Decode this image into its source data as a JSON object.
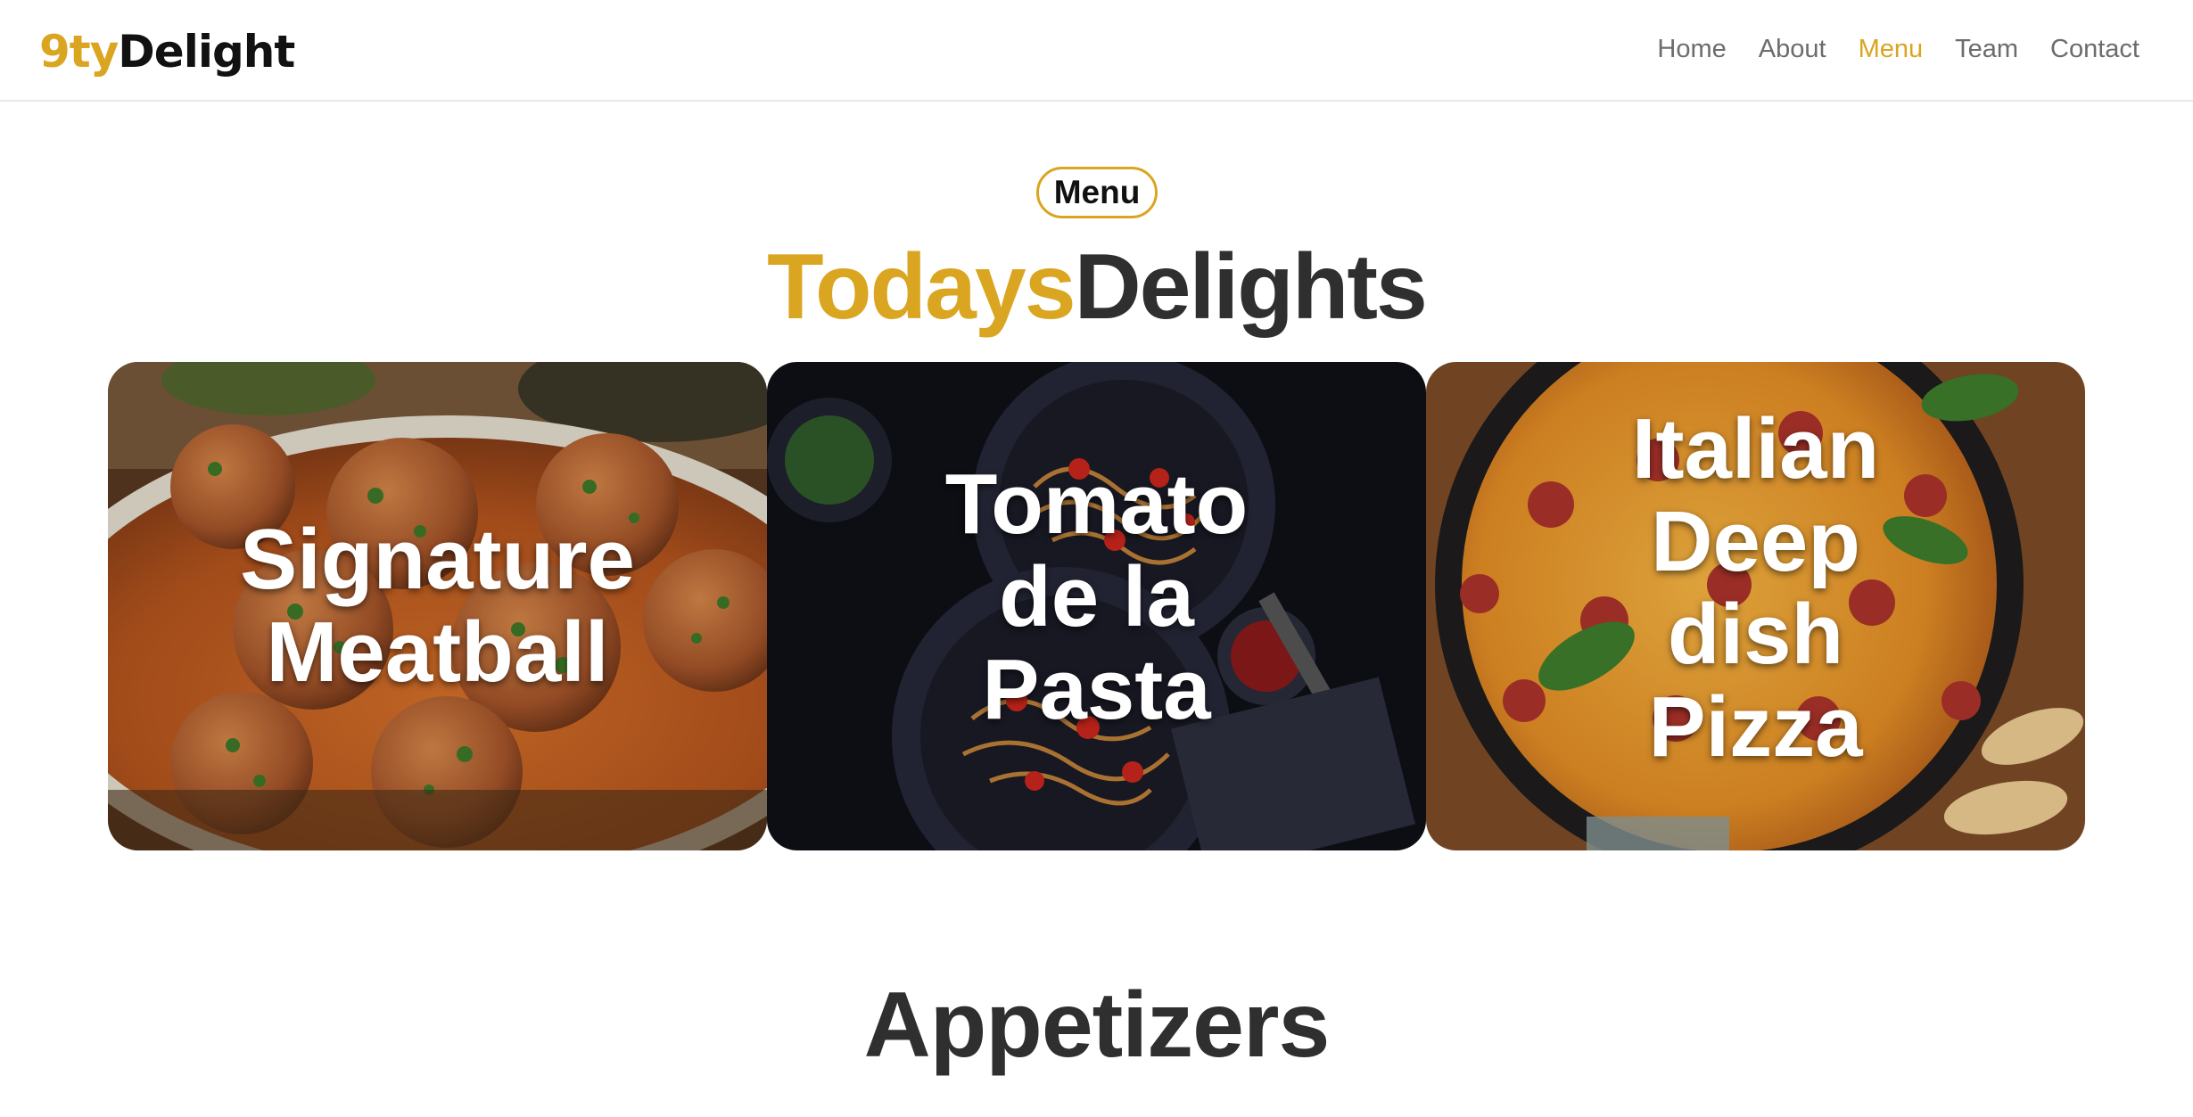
{
  "brand": {
    "logo_accent": "9ty",
    "logo_rest": "Delight",
    "accent_color": "#daa520",
    "dark_color": "#2f2f2f"
  },
  "nav": {
    "items": [
      {
        "label": "Home",
        "active": false
      },
      {
        "label": "About",
        "active": false
      },
      {
        "label": "Menu",
        "active": true
      },
      {
        "label": "Team",
        "active": false
      },
      {
        "label": "Contact",
        "active": false
      }
    ]
  },
  "menu_section": {
    "pill_label": "Menu",
    "headline_accent": "Todays",
    "headline_rest": "Delights"
  },
  "cards": [
    {
      "title": "Signature Meatball",
      "image": "meatballs-in-sauce-photo"
    },
    {
      "title": "Tomato de la Pasta",
      "image": "spaghetti-seafood-dark-plates-photo"
    },
    {
      "title": "Italian Deep dish Pizza",
      "image": "deep-dish-pepperoni-pizza-photo"
    }
  ],
  "appetizers": {
    "heading": "Appetizers"
  }
}
